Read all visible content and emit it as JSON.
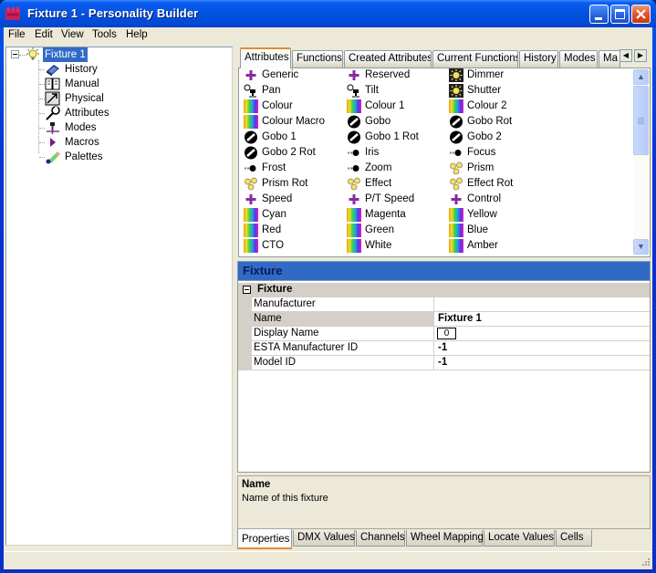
{
  "window": {
    "title": "Fixture 1 - Personality Builder",
    "controls": [
      "minimize",
      "maximize",
      "close"
    ]
  },
  "menu": [
    "File",
    "Edit",
    "View",
    "Tools",
    "Help"
  ],
  "tree": {
    "root": {
      "label": "Fixture 1",
      "icon": "lightbulb-icon",
      "expanded": true,
      "selected": true
    },
    "children": [
      {
        "label": "History",
        "icon": "history-icon"
      },
      {
        "label": "Manual",
        "icon": "manual-book-icon"
      },
      {
        "label": "Physical",
        "icon": "physical-icon"
      },
      {
        "label": "Attributes",
        "icon": "wrench-icon"
      },
      {
        "label": "Modes",
        "icon": "modes-icon"
      },
      {
        "label": "Macros",
        "icon": "macro-play-icon"
      },
      {
        "label": "Palettes",
        "icon": "palette-pencil-icon"
      }
    ]
  },
  "top_tabs": {
    "items": [
      "Attributes",
      "Functions",
      "Created Attributes",
      "Current Functions",
      "History",
      "Modes",
      "Ma"
    ],
    "active": "Attributes"
  },
  "attributes": {
    "columns": [
      [
        {
          "label": "Generic",
          "icon": "plus"
        },
        {
          "label": "Pan",
          "icon": "pan-tilt"
        },
        {
          "label": "Colour",
          "icon": "colour"
        },
        {
          "label": "Colour Macro",
          "icon": "colour"
        },
        {
          "label": "Gobo 1",
          "icon": "gobo"
        },
        {
          "label": "Gobo 2 Rot",
          "icon": "gobo"
        },
        {
          "label": "Frost",
          "icon": "beam"
        },
        {
          "label": "Prism Rot",
          "icon": "prism"
        },
        {
          "label": "Speed",
          "icon": "plus"
        },
        {
          "label": "Cyan",
          "icon": "colour"
        },
        {
          "label": "Red",
          "icon": "colour"
        },
        {
          "label": "CTO",
          "icon": "colour"
        }
      ],
      [
        {
          "label": "Reserved",
          "icon": "plus"
        },
        {
          "label": "Tilt",
          "icon": "pan-tilt"
        },
        {
          "label": "Colour 1",
          "icon": "colour"
        },
        {
          "label": "Gobo",
          "icon": "gobo"
        },
        {
          "label": "Gobo 1 Rot",
          "icon": "gobo"
        },
        {
          "label": "Iris",
          "icon": "beam"
        },
        {
          "label": "Zoom",
          "icon": "beam"
        },
        {
          "label": "Effect",
          "icon": "prism"
        },
        {
          "label": "P/T Speed",
          "icon": "plus"
        },
        {
          "label": "Magenta",
          "icon": "colour"
        },
        {
          "label": "Green",
          "icon": "colour"
        },
        {
          "label": "White",
          "icon": "colour"
        }
      ],
      [
        {
          "label": "Dimmer",
          "icon": "sun"
        },
        {
          "label": "Shutter",
          "icon": "sun"
        },
        {
          "label": "Colour 2",
          "icon": "colour"
        },
        {
          "label": "Gobo Rot",
          "icon": "gobo"
        },
        {
          "label": "Gobo 2",
          "icon": "gobo"
        },
        {
          "label": "Focus",
          "icon": "beam"
        },
        {
          "label": "Prism",
          "icon": "prism"
        },
        {
          "label": "Effect Rot",
          "icon": "prism"
        },
        {
          "label": "Control",
          "icon": "plus"
        },
        {
          "label": "Yellow",
          "icon": "colour"
        },
        {
          "label": "Blue",
          "icon": "colour"
        },
        {
          "label": "Amber",
          "icon": "colour"
        }
      ]
    ]
  },
  "properties": {
    "header": "Fixture",
    "category": "Fixture",
    "rows": [
      {
        "key": "Manufacturer",
        "value": ""
      },
      {
        "key": "Name",
        "value": "Fixture 1",
        "selected": true
      },
      {
        "key": "Display Name",
        "value": "0",
        "boxed": true
      },
      {
        "key": "ESTA Manufacturer ID",
        "value": "-1"
      },
      {
        "key": "Model ID",
        "value": "-1"
      }
    ]
  },
  "help": {
    "title": "Name",
    "description": "Name of this fixture"
  },
  "bottom_tabs": {
    "items": [
      "Properties",
      "DMX Values",
      "Channels",
      "Wheel Mapping",
      "Locate Values",
      "Cells"
    ],
    "active": "Properties"
  },
  "colors": {
    "titlebar": "#0353e0",
    "selection": "#316ac5",
    "face": "#ece9d8",
    "plus_icon": "#8a2aa0"
  }
}
